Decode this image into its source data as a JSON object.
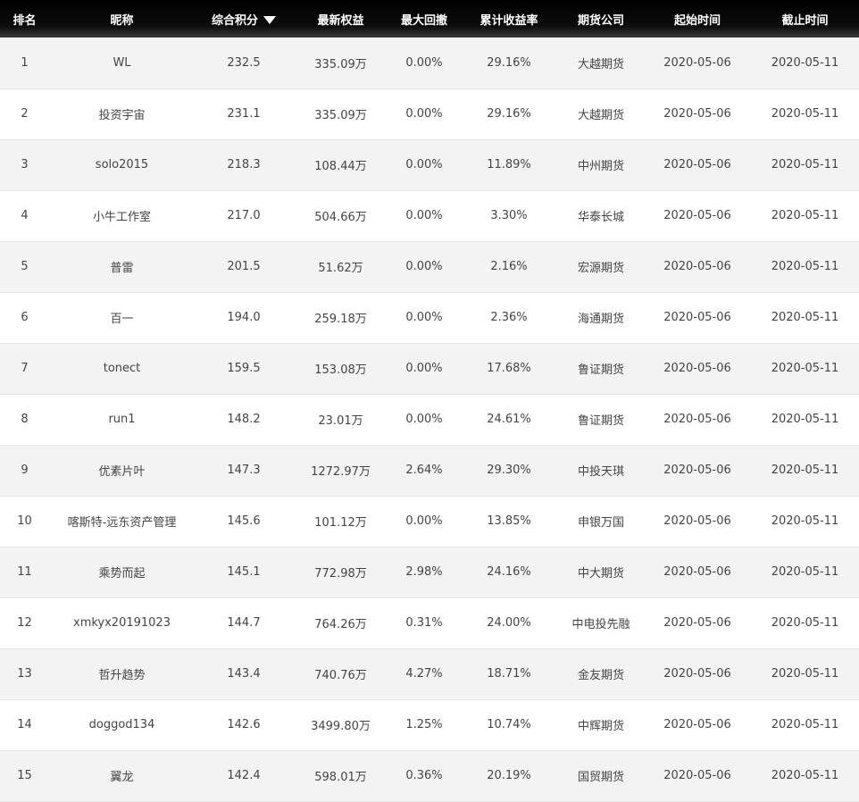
{
  "table": {
    "headers": [
      "排名",
      "昵称",
      "综合积分",
      "最新权益",
      "最大回撤",
      "累计收益率",
      "期货公司",
      "起始时间",
      "截止时间"
    ],
    "sort_indicator": "sort-down-icon",
    "rows": [
      [
        "1",
        "WL",
        "232.5",
        "335.09万",
        "0.00%",
        "29.16%",
        "大越期货",
        "2020-05-06",
        "2020-05-11"
      ],
      [
        "2",
        "投资宇宙",
        "231.1",
        "335.09万",
        "0.00%",
        "29.16%",
        "大越期货",
        "2020-05-06",
        "2020-05-11"
      ],
      [
        "3",
        "solo2015",
        "218.3",
        "108.44万",
        "0.00%",
        "11.89%",
        "中州期货",
        "2020-05-06",
        "2020-05-11"
      ],
      [
        "4",
        "小牛工作室",
        "217.0",
        "504.66万",
        "0.00%",
        "3.30%",
        "华泰长城",
        "2020-05-06",
        "2020-05-11"
      ],
      [
        "5",
        "普雷",
        "201.5",
        "51.62万",
        "0.00%",
        "2.16%",
        "宏源期货",
        "2020-05-06",
        "2020-05-11"
      ],
      [
        "6",
        "百一",
        "194.0",
        "259.18万",
        "0.00%",
        "2.36%",
        "海通期货",
        "2020-05-06",
        "2020-05-11"
      ],
      [
        "7",
        "tonect",
        "159.5",
        "153.08万",
        "0.00%",
        "17.68%",
        "鲁证期货",
        "2020-05-06",
        "2020-05-11"
      ],
      [
        "8",
        "run1",
        "148.2",
        "23.01万",
        "0.00%",
        "24.61%",
        "鲁证期货",
        "2020-05-06",
        "2020-05-11"
      ],
      [
        "9",
        "优素片叶",
        "147.3",
        "1272.97万",
        "2.64%",
        "29.30%",
        "中投天琪",
        "2020-05-06",
        "2020-05-11"
      ],
      [
        "10",
        "喀斯特-远东资产管理",
        "145.6",
        "101.12万",
        "0.00%",
        "13.85%",
        "申银万国",
        "2020-05-06",
        "2020-05-11"
      ],
      [
        "11",
        "乘势而起",
        "145.1",
        "772.98万",
        "2.98%",
        "24.16%",
        "中大期货",
        "2020-05-06",
        "2020-05-11"
      ],
      [
        "12",
        "xmkyx20191023",
        "144.7",
        "764.26万",
        "0.31%",
        "24.00%",
        "中电投先融",
        "2020-05-06",
        "2020-05-11"
      ],
      [
        "13",
        "哲升趋势",
        "143.4",
        "740.76万",
        "4.27%",
        "18.71%",
        "金友期货",
        "2020-05-06",
        "2020-05-11"
      ],
      [
        "14",
        "doggod134",
        "142.6",
        "3499.80万",
        "1.25%",
        "10.74%",
        "中辉期货",
        "2020-05-06",
        "2020-05-11"
      ],
      [
        "15",
        "翼龙",
        "142.4",
        "598.01万",
        "0.36%",
        "20.19%",
        "国贸期货",
        "2020-05-06",
        "2020-05-11"
      ]
    ]
  },
  "colors": {
    "header_bg": "#000000",
    "header_text": "#ffffff",
    "row_odd": "#f3f3f3",
    "row_even": "#ffffff",
    "cell_text": "#444444"
  }
}
